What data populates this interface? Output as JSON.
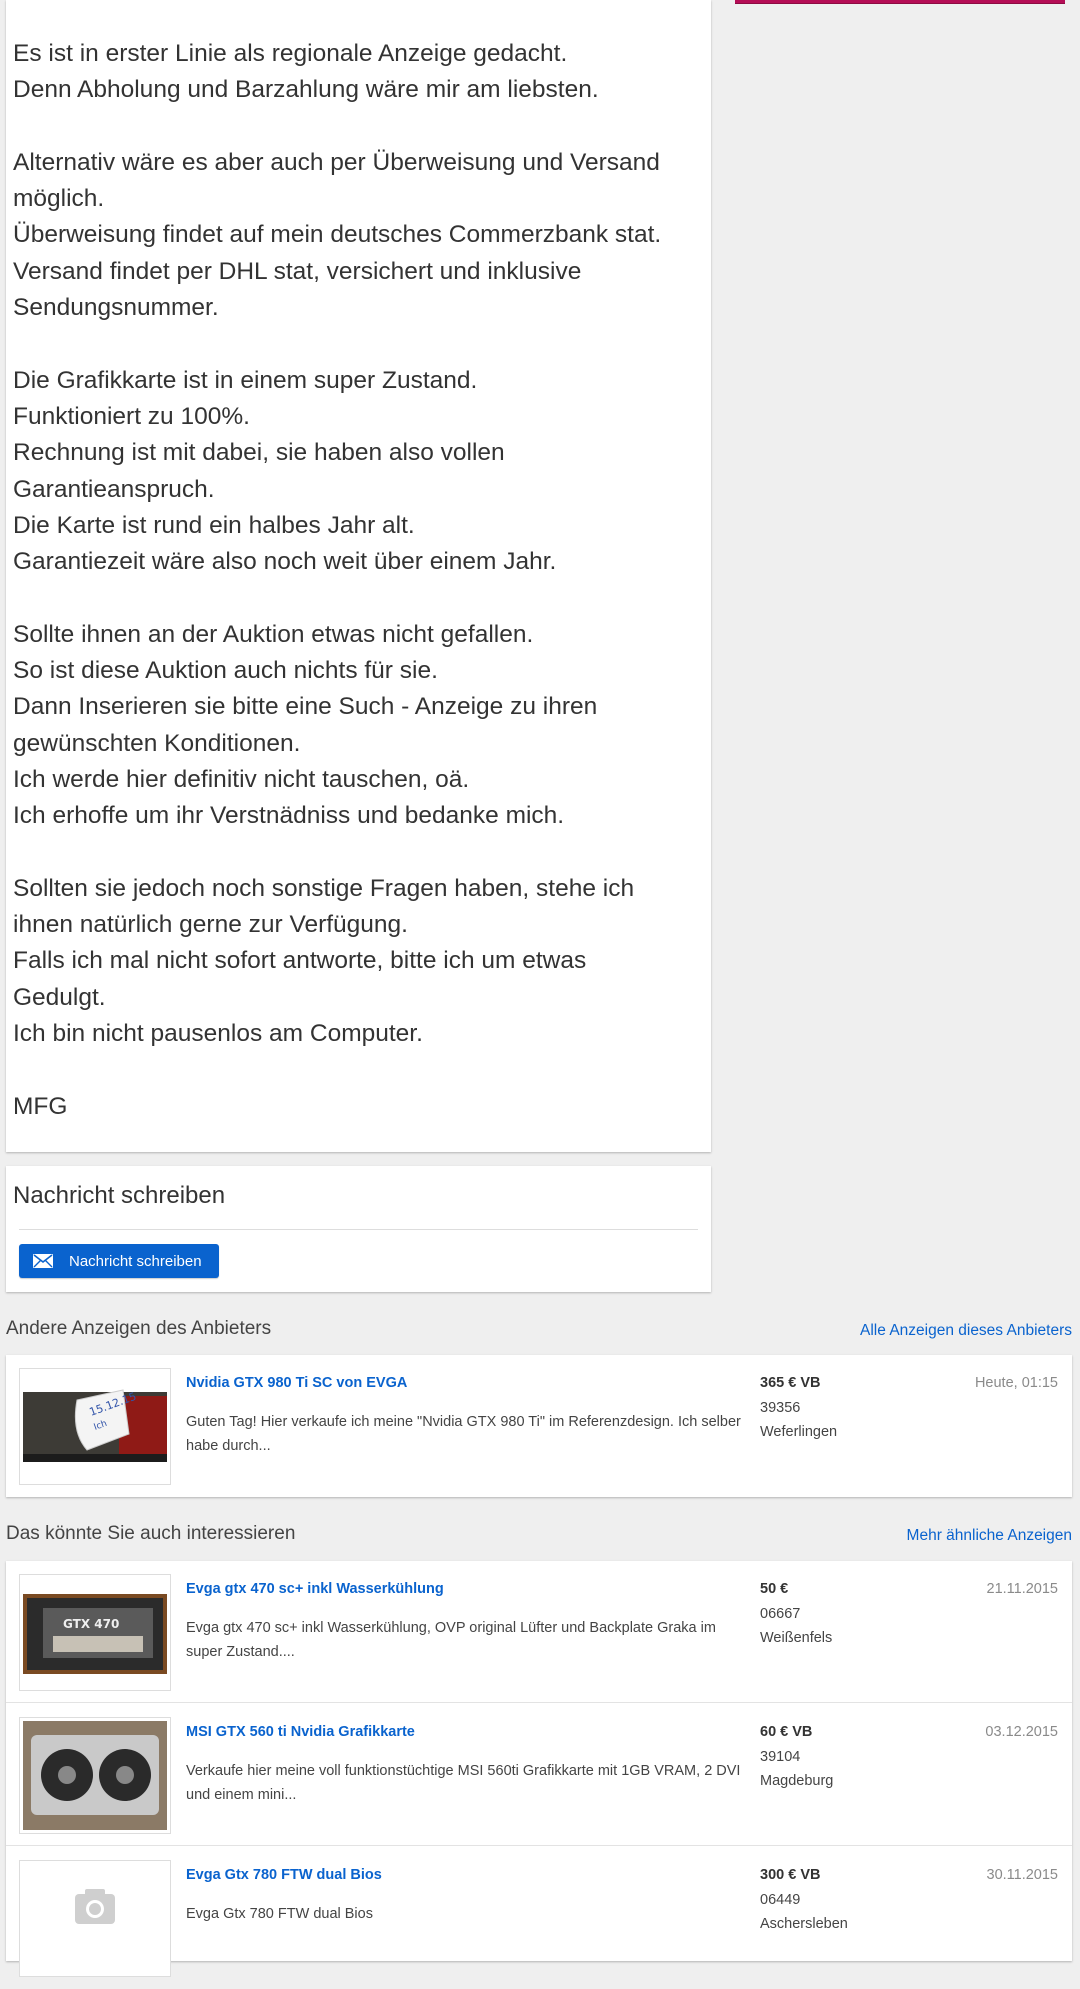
{
  "description": {
    "lines": [
      "Es ist in erster Linie als regionale Anzeige gedacht.",
      "Denn Abholung und Barzahlung wäre mir am liebsten.",
      "",
      "Alternativ wäre es aber auch per Überweisung und Versand",
      "möglich.",
      "Überweisung findet auf mein deutsches Commerzbank stat.",
      "Versand findet per DHL stat, versichert und inklusive",
      "Sendungsnummer.",
      "",
      "Die Grafikkarte ist in einem super Zustand.",
      "Funktioniert zu 100%.",
      "Rechnung ist mit dabei, sie haben also vollen",
      "Garantieanspruch.",
      "Die Karte ist rund ein halbes Jahr alt.",
      "Garantiezeit wäre also noch weit über einem Jahr.",
      "",
      "Sollte ihnen an der Auktion etwas nicht gefallen.",
      "So ist diese Auktion auch nichts für sie.",
      "Dann Inserieren sie bitte eine Such - Anzeige zu ihren",
      "gewünschten Konditionen.",
      "Ich werde hier definitiv nicht tauschen, oä.",
      "Ich erhoffe um ihr Verstnädniss und bedanke mich.",
      "",
      "Sollten sie jedoch noch sonstige Fragen haben, stehe ich",
      "ihnen natürlich gerne zur Verfügung.",
      "Falls ich mal nicht sofort antworte, bitte ich um etwas",
      "Gedulgt.",
      "Ich bin nicht pausenlos am Computer.",
      "",
      "MFG"
    ]
  },
  "message": {
    "title": "Nachricht schreiben",
    "button_label": "Nachricht schreiben",
    "icon": "envelope-icon"
  },
  "seller_ads": {
    "title": "Andere Anzeigen des Anbieters",
    "link": "Alle Anzeigen dieses Anbieters",
    "items": [
      {
        "title": "Nvidia GTX 980 Ti SC von EVGA",
        "desc": "Guten Tag! Hier verkaufe ich meine \"Nvidia GTX 980 Ti\" im Referenzdesign. Ich selber habe durch...",
        "price": "365 € VB",
        "zip": "39356",
        "city": "Weferlingen",
        "date": "Heute, 01:15"
      }
    ]
  },
  "similar_ads": {
    "title": "Das könnte Sie auch interessieren",
    "link": "Mehr ähnliche Anzeigen",
    "items": [
      {
        "title": "Evga gtx 470 sc+ inkl Wasserkühlung",
        "desc": "Evga gtx 470 sc+ inkl Wasserkühlung, OVP original Lüfter und Backplate Graka im super Zustand....",
        "price": "50 €",
        "zip": "06667",
        "city": "Weißenfels",
        "date": "21.11.2015"
      },
      {
        "title": "MSI GTX 560 ti Nvidia Grafikkarte",
        "desc": "Verkaufe hier meine voll funktionstüchtige MSI 560ti Grafikkarte mit 1GB VRAM, 2 DVI und einem mini...",
        "price": "60 € VB",
        "zip": "39104",
        "city": "Magdeburg",
        "date": "03.12.2015"
      },
      {
        "title": "Evga Gtx 780 FTW dual Bios",
        "desc": "Evga Gtx 780 FTW dual Bios",
        "price": "300 € VB",
        "zip": "06449",
        "city": "Aschersleben",
        "date": "30.11.2015"
      }
    ]
  },
  "colors": {
    "accent": "#0a63ce",
    "highlight": "#b50d56",
    "background": "#efefef"
  }
}
